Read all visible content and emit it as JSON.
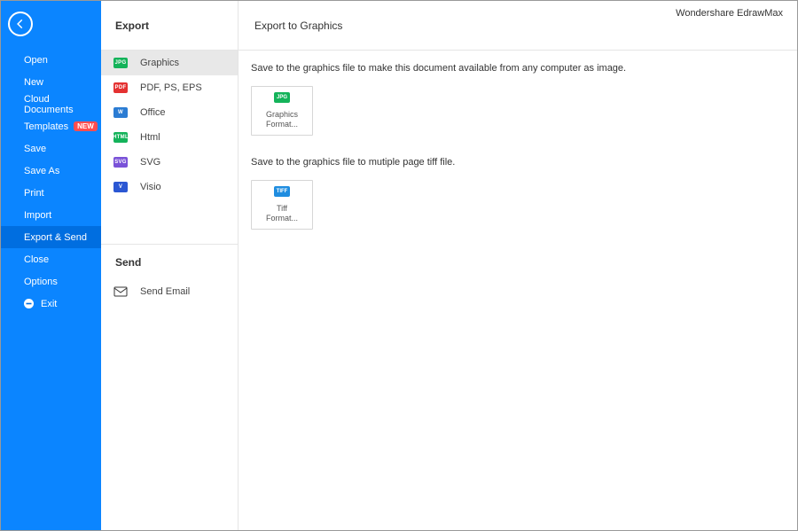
{
  "app_title": "Wondershare EdrawMax",
  "sidebar": {
    "items": [
      {
        "label": "Open"
      },
      {
        "label": "New"
      },
      {
        "label": "Cloud Documents"
      },
      {
        "label": "Templates",
        "badge": "NEW"
      },
      {
        "label": "Save"
      },
      {
        "label": "Save As"
      },
      {
        "label": "Print"
      },
      {
        "label": "Import"
      },
      {
        "label": "Export & Send",
        "active": true
      },
      {
        "label": "Close"
      },
      {
        "label": "Options"
      },
      {
        "label": "Exit",
        "icon": "exit-icon"
      }
    ]
  },
  "midcol": {
    "export_header": "Export",
    "export_items": [
      {
        "label": "Graphics",
        "icon": "jpg",
        "icon_text": "JPG",
        "selected": true
      },
      {
        "label": "PDF, PS, EPS",
        "icon": "pdf",
        "icon_text": "PDF"
      },
      {
        "label": "Office",
        "icon": "w",
        "icon_text": "W"
      },
      {
        "label": "Html",
        "icon": "html",
        "icon_text": "HTML"
      },
      {
        "label": "SVG",
        "icon": "svg",
        "icon_text": "SVG"
      },
      {
        "label": "Visio",
        "icon": "v",
        "icon_text": "V"
      }
    ],
    "send_header": "Send",
    "send_items": [
      {
        "label": "Send Email"
      }
    ]
  },
  "main": {
    "header": "Export to Graphics",
    "desc1": "Save to the graphics file to make this document available from any computer as image.",
    "tile1_icon_text": "JPG",
    "tile1_label": "Graphics\nFormat...",
    "desc2": "Save to the graphics file to mutiple page tiff file.",
    "tile2_icon_text": "TIFF",
    "tile2_label": "Tiff\nFormat..."
  }
}
